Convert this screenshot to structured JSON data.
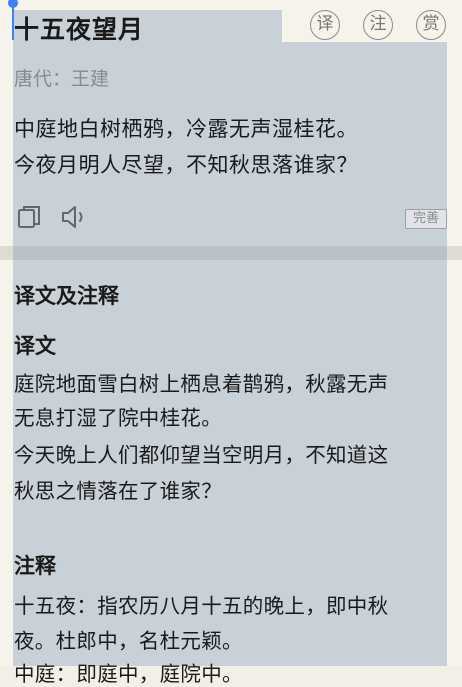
{
  "poem": {
    "title": "十五夜望月",
    "author": "唐代：王建",
    "lines": [
      "中庭地白树栖鸦，冷露无声湿桂花。",
      "今夜月明人尽望，不知秋思落谁家？"
    ],
    "buttons": {
      "translate": "译",
      "annotate": "注",
      "appreciate": "赏"
    },
    "perfect_label": "完善"
  },
  "annotation": {
    "section_title": "译文及注释",
    "translation_title": "译文",
    "translation_lines": [
      "庭院地面雪白树上栖息着鹊鸦，秋露无声",
      "无息打湿了院中桂花。",
      "今天晚上人们都仰望当空明月，不知道这",
      "秋思之情落在了谁家？"
    ],
    "notes_title": "注释",
    "notes_lines": [
      "十五夜：指农历八月十五的晚上，即中秋",
      "夜。杜郎中，名杜元颖。",
      "中庭：即庭中，庭院中。"
    ]
  },
  "colors": {
    "selection": "#c9d1d8",
    "background": "#f6f3ea",
    "cursor": "#3b82f6"
  },
  "icons": [
    "copy-icon",
    "speaker-icon"
  ]
}
